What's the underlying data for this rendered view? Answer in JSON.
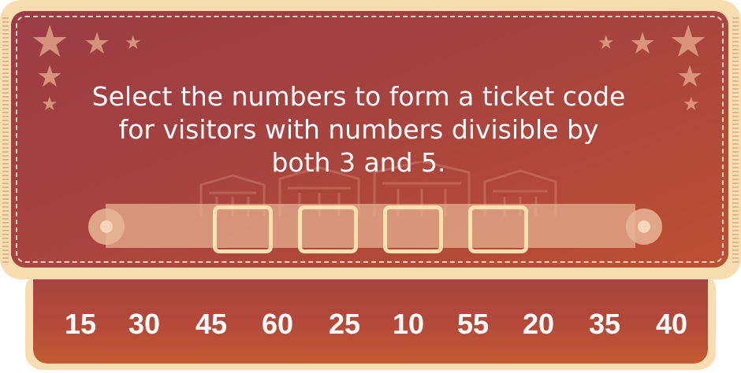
{
  "prompt": "Select the numbers to form a ticket code for visitors with numbers divisible by both 3 and 5.",
  "slots": [
    "",
    "",
    "",
    ""
  ],
  "numbers": [
    "15",
    "30",
    "45",
    "60",
    "25",
    "10",
    "55",
    "20",
    "35",
    "40"
  ],
  "colors": {
    "ticket_border": "#f8ddb0",
    "ticket_fill": "#a7433f",
    "slot_border": "#fbe0b2",
    "text": "#ffffff"
  },
  "icons": [
    "star-icon",
    "circus-tent-icon"
  ]
}
